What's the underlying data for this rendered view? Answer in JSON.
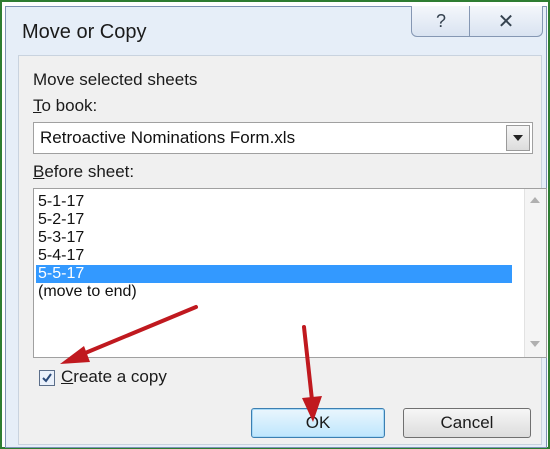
{
  "dialog": {
    "title": "Move or Copy",
    "help_button": "?",
    "close_button": "✕"
  },
  "move_label": "Move selected sheets",
  "to_book": {
    "label_rest": "o book:",
    "label_underline": "T",
    "value": "Retroactive Nominations Form.xls"
  },
  "before_sheet": {
    "label_underline": "B",
    "label_rest": "efore sheet:",
    "items": [
      "5-1-17",
      "5-2-17",
      "5-3-17",
      "5-4-17",
      "5-5-17",
      "(move to end)"
    ],
    "selected": "5-5-17"
  },
  "create_copy": {
    "label_underline": "C",
    "label_rest": "reate a copy",
    "checked": true
  },
  "buttons": {
    "ok": "OK",
    "cancel": "Cancel"
  },
  "colors": {
    "selection": "#3399ff",
    "annotation_arrow": "#c0191f"
  }
}
